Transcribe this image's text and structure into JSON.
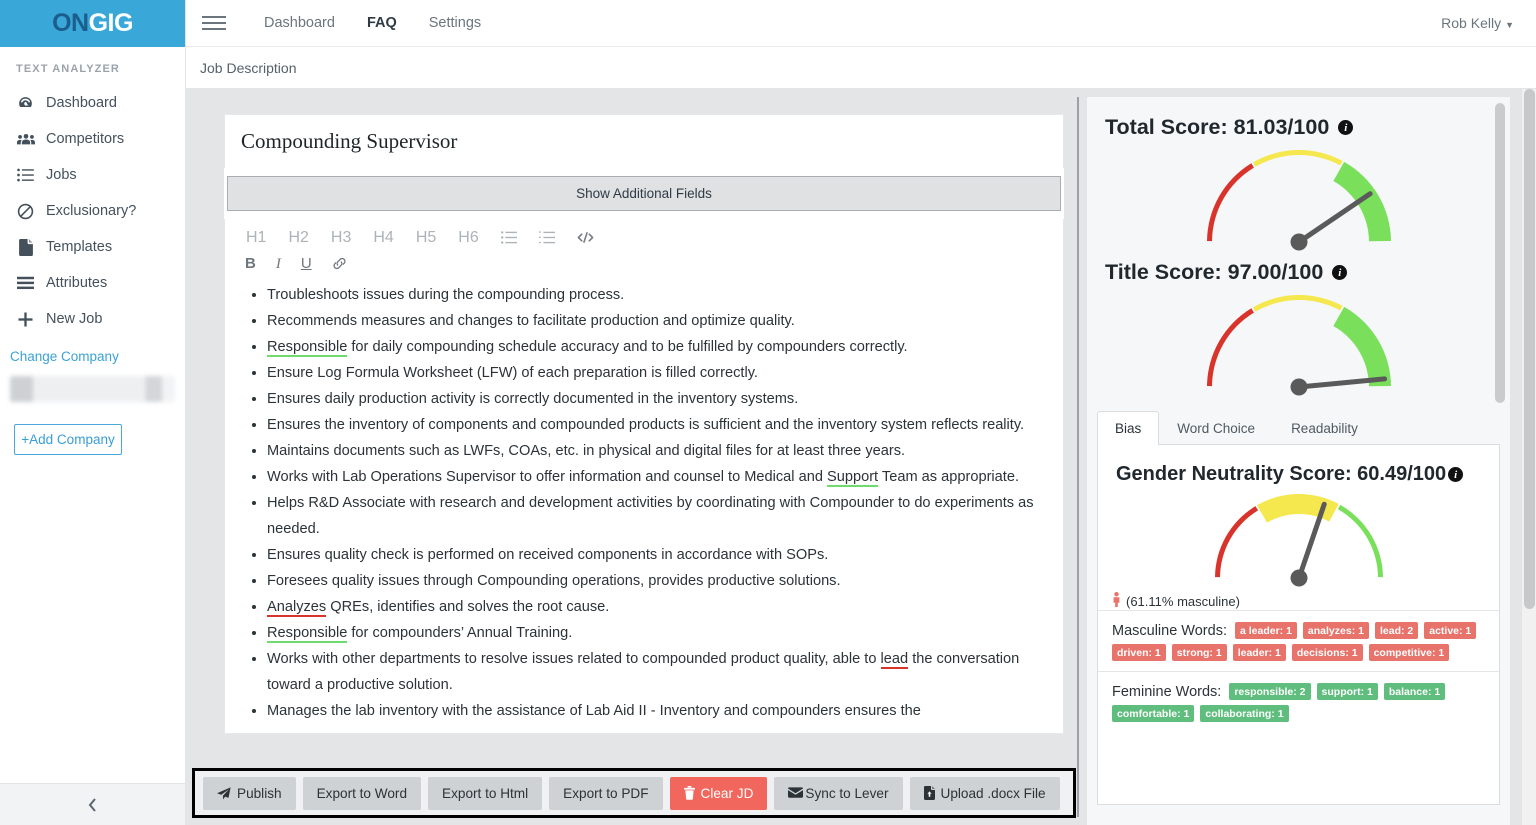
{
  "brand": {
    "logo_on": "ON",
    "logo_gig": "GIG",
    "accent": "#39a7d8"
  },
  "topnav": {
    "items": [
      {
        "label": "Dashboard",
        "bold": false
      },
      {
        "label": "FAQ",
        "bold": true
      },
      {
        "label": "Settings",
        "bold": false
      }
    ],
    "user": "Rob Kelly"
  },
  "breadcrumb": {
    "label": "Job Description"
  },
  "sidebar": {
    "section_title": "TEXT ANALYZER",
    "items": [
      {
        "label": "Dashboard",
        "icon": "speedometer-icon"
      },
      {
        "label": "Competitors",
        "icon": "users-icon"
      },
      {
        "label": "Jobs",
        "icon": "list-icon"
      },
      {
        "label": "Exclusionary?",
        "icon": "ban-icon"
      },
      {
        "label": "Templates",
        "icon": "file-icon"
      },
      {
        "label": "Attributes",
        "icon": "bars-icon"
      },
      {
        "label": "New Job",
        "icon": "plus-icon"
      }
    ],
    "change_company": "Change Company",
    "add_company": "+Add Company",
    "collapse": "‹"
  },
  "editor": {
    "job_title": "Compounding Supervisor",
    "show_additional_fields": "Show Additional Fields",
    "toolbar_row1": [
      "H1",
      "H2",
      "H3",
      "H4",
      "H5",
      "H6"
    ],
    "toolbar_icons_row1": [
      "bullet-list-icon",
      "numbered-list-icon",
      "code-icon"
    ],
    "toolbar_row2": [
      "B",
      "I",
      "U"
    ],
    "toolbar_icons_row2": [
      "link-icon"
    ],
    "bullets": [
      {
        "text": "Troubleshoots issues during the compounding process."
      },
      {
        "text": "Recommends measures and changes to facilitate production and optimize quality."
      },
      {
        "pre": "",
        "hl": "Responsible",
        "hl_type": "green",
        "post": " for daily compounding schedule accuracy and to be fulfilled by compounders correctly."
      },
      {
        "text": "Ensure Log Formula Worksheet (LFW) of each preparation is filled correctly."
      },
      {
        "text": "Ensures daily production activity is correctly documented in the inventory systems."
      },
      {
        "text": "Ensures the inventory of components and compounded products is sufficient and the inventory system reflects reality."
      },
      {
        "text": "Maintains documents such as  LWFs, COAs, etc. in physical and digital files for at least three years."
      },
      {
        "pre": "Works with Lab Operations Supervisor to offer information and counsel to Medical and ",
        "hl": "Support",
        "hl_type": "green",
        "post": " Team as appropriate."
      },
      {
        "text": "Helps R&D Associate with research and development activities by coordinating with Compounder to do experiments as needed."
      },
      {
        "text": "Ensures quality check is performed on received components in accordance with SOPs."
      },
      {
        "text": "Foresees quality issues through Compounding operations, provides productive solutions."
      },
      {
        "pre": "",
        "hl": "Analyzes",
        "hl_type": "red",
        "post": " QREs, identifies and solves the root cause."
      },
      {
        "pre": "",
        "hl": "Responsible",
        "hl_type": "green",
        "post": " for compounders’ Annual Training."
      },
      {
        "pre": "Works with other departments to resolve issues related to compounded product quality, able to ",
        "hl": "lead",
        "hl_type": "red",
        "post": " the conversation toward a productive solution."
      },
      {
        "text": "Manages the lab inventory with the assistance of Lab Aid II - Inventory and compounders ensures the"
      }
    ]
  },
  "actions": [
    {
      "label": "Publish",
      "icon": "send-icon",
      "style": "default"
    },
    {
      "label": "Export to Word",
      "icon": "",
      "style": "default"
    },
    {
      "label": "Export to Html",
      "icon": "",
      "style": "default"
    },
    {
      "label": "Export to PDF",
      "icon": "",
      "style": "default"
    },
    {
      "label": "Clear JD",
      "icon": "trash-icon",
      "style": "danger"
    },
    {
      "label": "Sync to Lever",
      "icon": "envelope-icon",
      "style": "default"
    },
    {
      "label": "Upload .docx File",
      "icon": "upload-file-icon",
      "style": "default"
    }
  ],
  "scores": {
    "total": {
      "label": "Total Score: 81.03/100",
      "value": 81.03
    },
    "title": {
      "label": "Title Score: 97.00/100",
      "value": 97.0
    },
    "gender_neutrality": {
      "label": "Gender Neutrality Score: 60.49/100",
      "value": 60.49
    },
    "masculine_pct_text": "(61.11% masculine)"
  },
  "tabs": [
    {
      "label": "Bias",
      "active": true
    },
    {
      "label": "Word Choice",
      "active": false
    },
    {
      "label": "Readability",
      "active": false
    }
  ],
  "words": {
    "masculine_label": "Masculine Words:",
    "masculine": [
      "a leader: 1",
      "analyzes: 1",
      "lead: 2",
      "active: 1",
      "driven: 1",
      "strong: 1",
      "leader: 1",
      "decisions: 1",
      "competitive: 1"
    ],
    "feminine_label": "Feminine Words:",
    "feminine": [
      "responsible: 2",
      "support: 1",
      "balance: 1",
      "comfortable: 1",
      "collaborating: 1"
    ]
  },
  "chart_data": [
    {
      "type": "gauge",
      "title": "Total Score",
      "value": 81.03,
      "range": [
        0,
        100
      ],
      "bands": [
        {
          "from": 0,
          "to": 33,
          "color": "#d9342b"
        },
        {
          "from": 33,
          "to": 66,
          "color": "#f5e74e"
        },
        {
          "from": 66,
          "to": 100,
          "color": "#7ae05c"
        }
      ]
    },
    {
      "type": "gauge",
      "title": "Title Score",
      "value": 97.0,
      "range": [
        0,
        100
      ],
      "bands": [
        {
          "from": 0,
          "to": 33,
          "color": "#d9342b"
        },
        {
          "from": 33,
          "to": 66,
          "color": "#f5e74e"
        },
        {
          "from": 66,
          "to": 100,
          "color": "#7ae05c"
        }
      ]
    },
    {
      "type": "gauge",
      "title": "Gender Neutrality Score",
      "value": 60.49,
      "range": [
        0,
        100
      ],
      "bands": [
        {
          "from": 0,
          "to": 33,
          "color": "#d9342b"
        },
        {
          "from": 33,
          "to": 66,
          "color": "#f5e74e"
        },
        {
          "from": 66,
          "to": 100,
          "color": "#7ae05c"
        }
      ]
    }
  ]
}
